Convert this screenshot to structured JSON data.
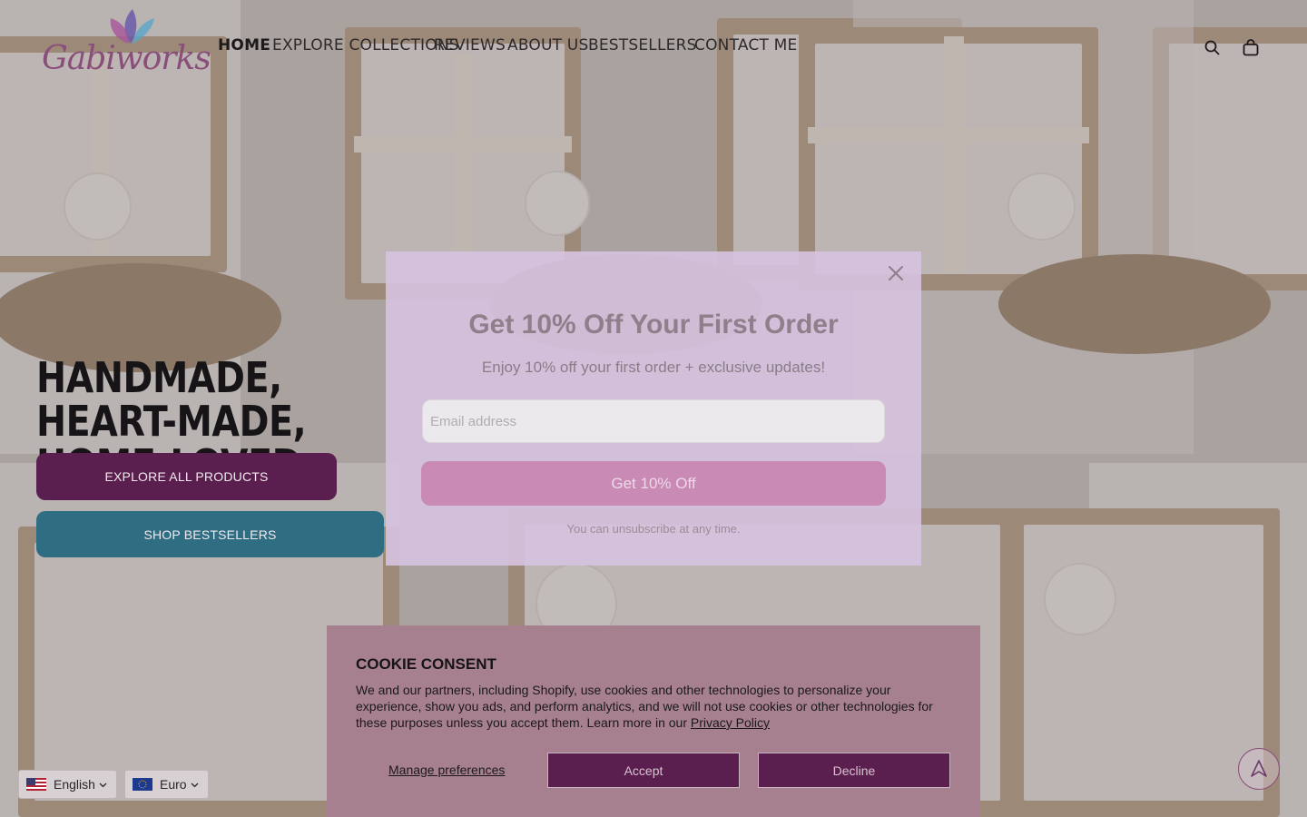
{
  "header": {
    "logo_text": "Gabiworks",
    "nav": [
      {
        "label": "Home",
        "active": true
      },
      {
        "label": "Explore Collections",
        "active": false
      },
      {
        "label": "Reviews",
        "active": false
      },
      {
        "label": "About Us",
        "active": false
      },
      {
        "label": "Bestsellers",
        "active": false
      },
      {
        "label": "Contact Me",
        "active": false
      }
    ],
    "icons": [
      "search-icon",
      "shopping-bag-icon"
    ]
  },
  "hero": {
    "title": "HANDMADE, HEART-MADE, HOME-LOVED",
    "explore_button": "EXPLORE ALL PRODUCTS",
    "bestsellers_button": "SHOP BESTSELLERS"
  },
  "popup": {
    "title": "Get 10% Off Your First Order",
    "subtitle": "Enjoy 10% off your first order + exclusive updates!",
    "email_placeholder": "Email address",
    "email_value": "",
    "submit_label": "Get 10% Off",
    "fine_print": "You can unsubscribe at any time.",
    "close_icon": "close-icon"
  },
  "cookie": {
    "title": "COOKIE CONSENT",
    "text": "We and our partners, including Shopify, use cookies and other technologies to personalize your experience, show you ads, and perform analytics, and we will not use cookies or other technologies for these purposes unless you accept them. Learn more in our ",
    "privacy_link": "Privacy Policy",
    "manage_label": "Manage preferences",
    "accept_label": "Accept",
    "decline_label": "Decline"
  },
  "locale": {
    "language": "English",
    "currency": "Euro"
  },
  "colors": {
    "primary_plum": "#5b1f4f",
    "teal": "#2f6d82",
    "popup_button": "#c98ab6",
    "logo_purple": "#8a4e7a"
  }
}
